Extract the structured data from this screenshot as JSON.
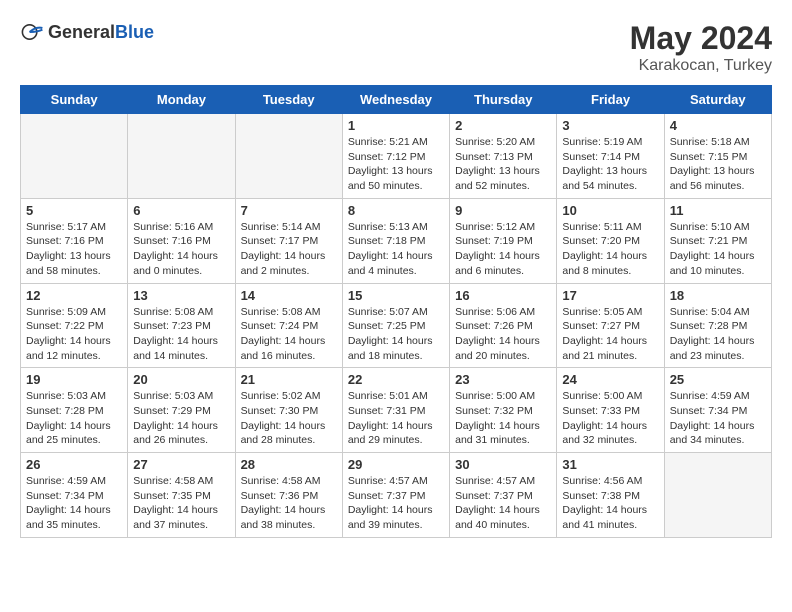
{
  "header": {
    "logo_general": "General",
    "logo_blue": "Blue",
    "title": "May 2024",
    "subtitle": "Karakocan, Turkey"
  },
  "days_of_week": [
    "Sunday",
    "Monday",
    "Tuesday",
    "Wednesday",
    "Thursday",
    "Friday",
    "Saturday"
  ],
  "weeks": [
    [
      {
        "day": "",
        "info": ""
      },
      {
        "day": "",
        "info": ""
      },
      {
        "day": "",
        "info": ""
      },
      {
        "day": "1",
        "info": "Sunrise: 5:21 AM\nSunset: 7:12 PM\nDaylight: 13 hours\nand 50 minutes."
      },
      {
        "day": "2",
        "info": "Sunrise: 5:20 AM\nSunset: 7:13 PM\nDaylight: 13 hours\nand 52 minutes."
      },
      {
        "day": "3",
        "info": "Sunrise: 5:19 AM\nSunset: 7:14 PM\nDaylight: 13 hours\nand 54 minutes."
      },
      {
        "day": "4",
        "info": "Sunrise: 5:18 AM\nSunset: 7:15 PM\nDaylight: 13 hours\nand 56 minutes."
      }
    ],
    [
      {
        "day": "5",
        "info": "Sunrise: 5:17 AM\nSunset: 7:16 PM\nDaylight: 13 hours\nand 58 minutes."
      },
      {
        "day": "6",
        "info": "Sunrise: 5:16 AM\nSunset: 7:16 PM\nDaylight: 14 hours\nand 0 minutes."
      },
      {
        "day": "7",
        "info": "Sunrise: 5:14 AM\nSunset: 7:17 PM\nDaylight: 14 hours\nand 2 minutes."
      },
      {
        "day": "8",
        "info": "Sunrise: 5:13 AM\nSunset: 7:18 PM\nDaylight: 14 hours\nand 4 minutes."
      },
      {
        "day": "9",
        "info": "Sunrise: 5:12 AM\nSunset: 7:19 PM\nDaylight: 14 hours\nand 6 minutes."
      },
      {
        "day": "10",
        "info": "Sunrise: 5:11 AM\nSunset: 7:20 PM\nDaylight: 14 hours\nand 8 minutes."
      },
      {
        "day": "11",
        "info": "Sunrise: 5:10 AM\nSunset: 7:21 PM\nDaylight: 14 hours\nand 10 minutes."
      }
    ],
    [
      {
        "day": "12",
        "info": "Sunrise: 5:09 AM\nSunset: 7:22 PM\nDaylight: 14 hours\nand 12 minutes."
      },
      {
        "day": "13",
        "info": "Sunrise: 5:08 AM\nSunset: 7:23 PM\nDaylight: 14 hours\nand 14 minutes."
      },
      {
        "day": "14",
        "info": "Sunrise: 5:08 AM\nSunset: 7:24 PM\nDaylight: 14 hours\nand 16 minutes."
      },
      {
        "day": "15",
        "info": "Sunrise: 5:07 AM\nSunset: 7:25 PM\nDaylight: 14 hours\nand 18 minutes."
      },
      {
        "day": "16",
        "info": "Sunrise: 5:06 AM\nSunset: 7:26 PM\nDaylight: 14 hours\nand 20 minutes."
      },
      {
        "day": "17",
        "info": "Sunrise: 5:05 AM\nSunset: 7:27 PM\nDaylight: 14 hours\nand 21 minutes."
      },
      {
        "day": "18",
        "info": "Sunrise: 5:04 AM\nSunset: 7:28 PM\nDaylight: 14 hours\nand 23 minutes."
      }
    ],
    [
      {
        "day": "19",
        "info": "Sunrise: 5:03 AM\nSunset: 7:28 PM\nDaylight: 14 hours\nand 25 minutes."
      },
      {
        "day": "20",
        "info": "Sunrise: 5:03 AM\nSunset: 7:29 PM\nDaylight: 14 hours\nand 26 minutes."
      },
      {
        "day": "21",
        "info": "Sunrise: 5:02 AM\nSunset: 7:30 PM\nDaylight: 14 hours\nand 28 minutes."
      },
      {
        "day": "22",
        "info": "Sunrise: 5:01 AM\nSunset: 7:31 PM\nDaylight: 14 hours\nand 29 minutes."
      },
      {
        "day": "23",
        "info": "Sunrise: 5:00 AM\nSunset: 7:32 PM\nDaylight: 14 hours\nand 31 minutes."
      },
      {
        "day": "24",
        "info": "Sunrise: 5:00 AM\nSunset: 7:33 PM\nDaylight: 14 hours\nand 32 minutes."
      },
      {
        "day": "25",
        "info": "Sunrise: 4:59 AM\nSunset: 7:34 PM\nDaylight: 14 hours\nand 34 minutes."
      }
    ],
    [
      {
        "day": "26",
        "info": "Sunrise: 4:59 AM\nSunset: 7:34 PM\nDaylight: 14 hours\nand 35 minutes."
      },
      {
        "day": "27",
        "info": "Sunrise: 4:58 AM\nSunset: 7:35 PM\nDaylight: 14 hours\nand 37 minutes."
      },
      {
        "day": "28",
        "info": "Sunrise: 4:58 AM\nSunset: 7:36 PM\nDaylight: 14 hours\nand 38 minutes."
      },
      {
        "day": "29",
        "info": "Sunrise: 4:57 AM\nSunset: 7:37 PM\nDaylight: 14 hours\nand 39 minutes."
      },
      {
        "day": "30",
        "info": "Sunrise: 4:57 AM\nSunset: 7:37 PM\nDaylight: 14 hours\nand 40 minutes."
      },
      {
        "day": "31",
        "info": "Sunrise: 4:56 AM\nSunset: 7:38 PM\nDaylight: 14 hours\nand 41 minutes."
      },
      {
        "day": "",
        "info": ""
      }
    ]
  ]
}
